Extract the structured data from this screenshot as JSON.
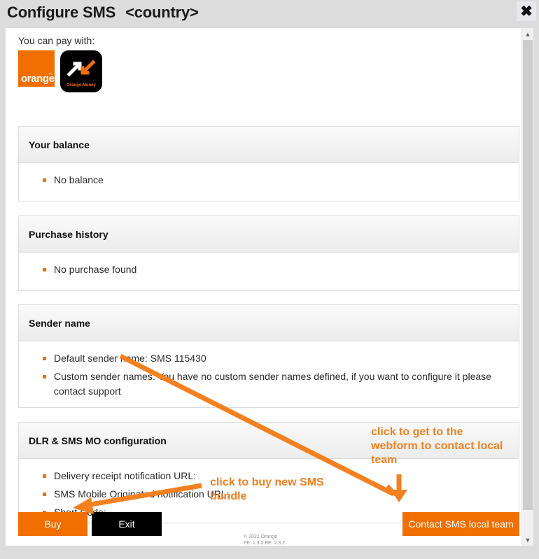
{
  "window": {
    "title": "Configure SMS",
    "country_placeholder": "<country>",
    "close_icon": "close-icon"
  },
  "payment": {
    "label": "You can pay with:",
    "methods": [
      {
        "name": "orange",
        "text": "orange",
        "tm": "™",
        "bg": "#f16e00"
      },
      {
        "name": "orange-money",
        "text": "Orange Money",
        "bg": "#000000"
      }
    ]
  },
  "panels": [
    {
      "id": "balance",
      "title": "Your balance",
      "items": [
        {
          "text": "No balance",
          "style": "orange"
        }
      ]
    },
    {
      "id": "purchase-history",
      "title": "Purchase history",
      "items": [
        {
          "text": "No purchase found",
          "style": "orange"
        }
      ]
    },
    {
      "id": "sender-name",
      "title": "Sender name",
      "items": [
        {
          "text": "Default sender name: SMS 115430",
          "style": "normal"
        },
        {
          "text": "Custom sender names: You have no custom sender names defined, if you want to configure it please contact support",
          "style": "normal"
        }
      ]
    },
    {
      "id": "dlr-sms-mo",
      "title": "DLR & SMS MO configuration",
      "items": [
        {
          "text": "Delivery receipt notification URL:",
          "style": "normal"
        },
        {
          "text": "SMS Mobile Originated notification URL:",
          "style": "normal"
        },
        {
          "text": "Short Code:",
          "style": "normal"
        }
      ]
    }
  ],
  "buttons": {
    "buy": "Buy",
    "exit": "Exit",
    "contact": "Contact SMS local team"
  },
  "annotations": {
    "buy_note": "click to buy new SMS bundle",
    "contact_note": "click to get to the webform to contact local team",
    "color": "#f58020"
  },
  "footer": {
    "copyright": "© 2022 Orange",
    "version": "FE: 1.3.2 BE: 2.3.2"
  },
  "scrollbar": {
    "up_icon": "chevron-up-icon",
    "down_icon": "chevron-down-icon"
  },
  "colors": {
    "orange": "#f16e00",
    "annotation_orange": "#f58020",
    "black": "#000000",
    "window_bg": "#dcdcdc"
  }
}
